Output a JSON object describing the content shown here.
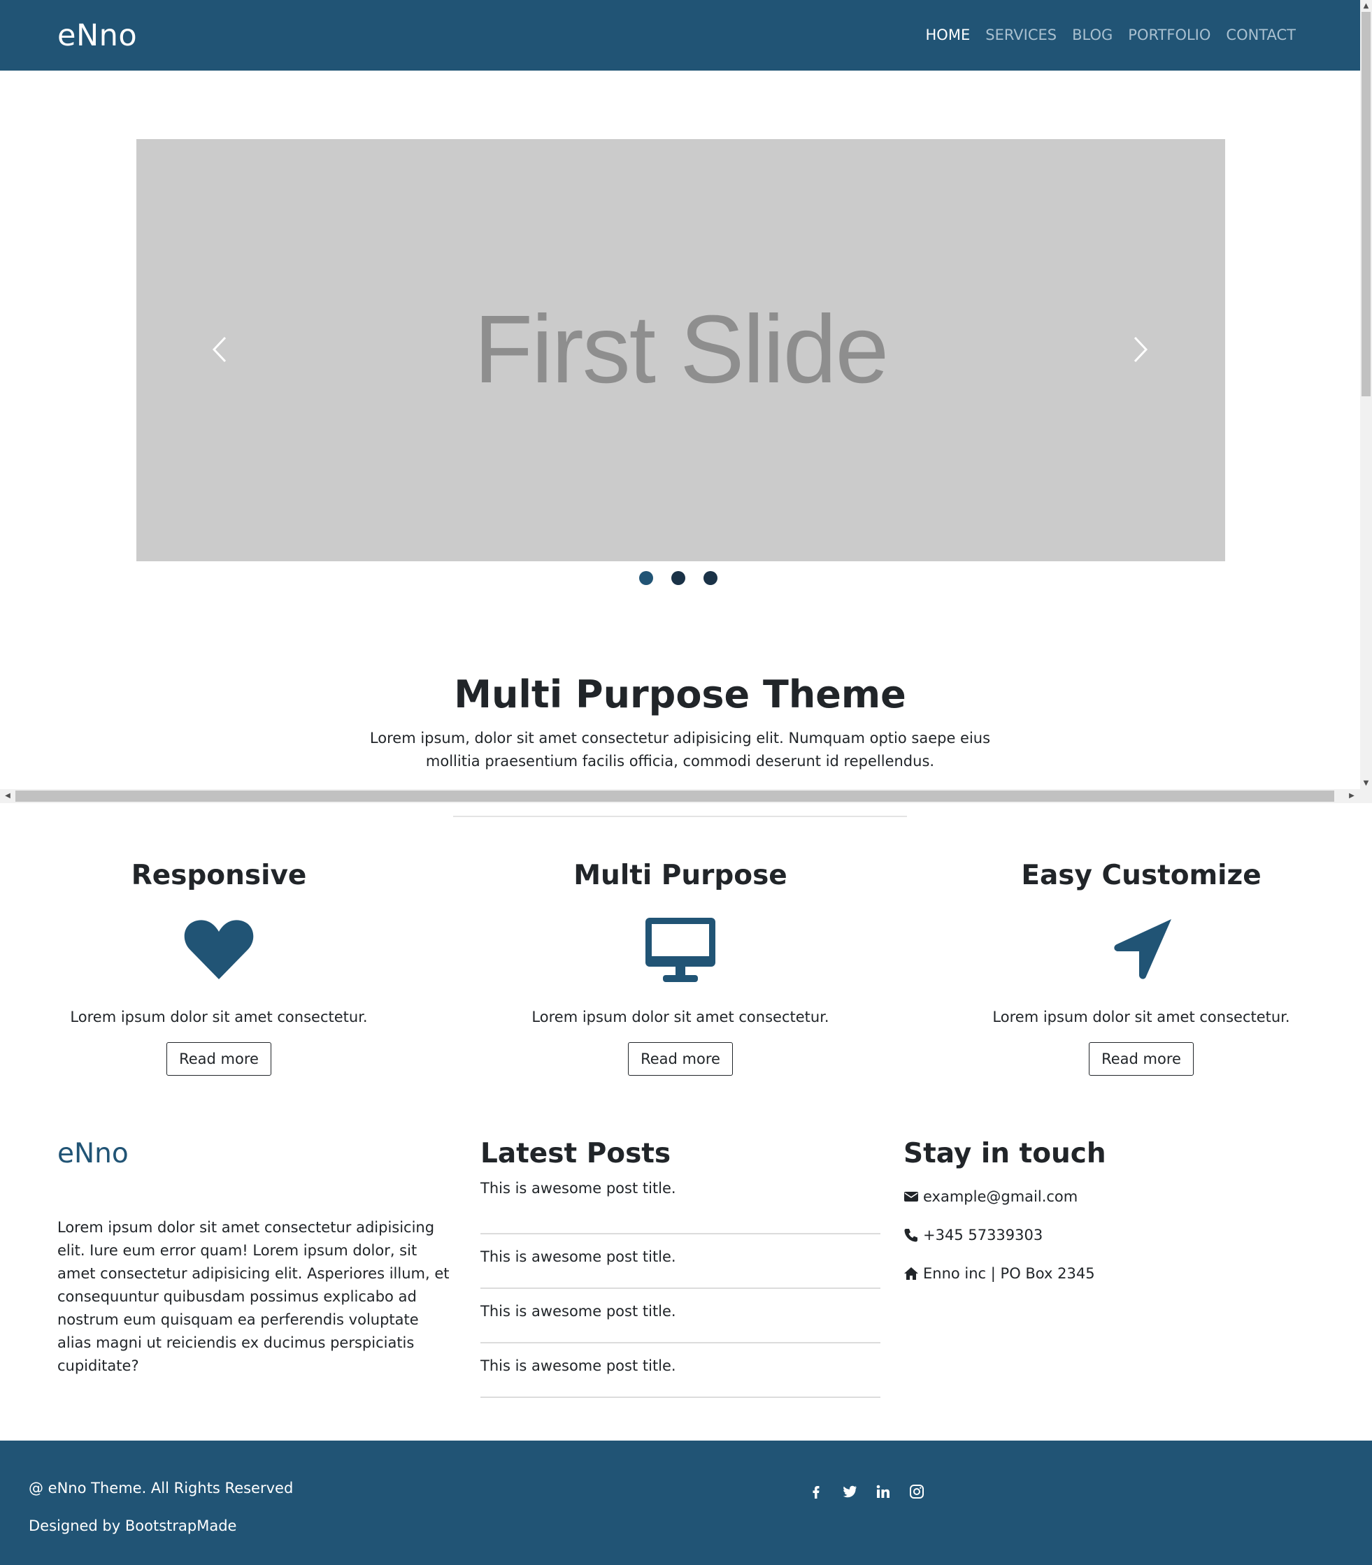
{
  "nav": {
    "brand": "eNno",
    "items": [
      {
        "label": "HOME"
      },
      {
        "label": "SERVICES"
      },
      {
        "label": "BLOG"
      },
      {
        "label": "PORTFOLIO"
      },
      {
        "label": "CONTACT"
      }
    ],
    "active_item": "HOME"
  },
  "slider": {
    "slide_text": "First Slide",
    "slide_count": 3,
    "active_index": 0
  },
  "intro": {
    "title": "Multi Purpose Theme",
    "text": "Lorem ipsum, dolor sit amet consectetur adipisicing elit. Numquam optio saepe eius mollitia praesentium facilis officia, commodi deserunt id repellendus."
  },
  "features": [
    {
      "title": "Responsive",
      "icon": "heart-icon",
      "text": "Lorem ipsum dolor sit amet consectetur.",
      "button": "Read more"
    },
    {
      "title": "Multi Purpose",
      "icon": "desktop-icon",
      "text": "Lorem ipsum dolor sit amet consectetur.",
      "button": "Read more"
    },
    {
      "title": "Easy Customize",
      "icon": "location-arrow-icon",
      "text": "Lorem ipsum dolor sit amet consectetur.",
      "button": "Read more"
    }
  ],
  "about": {
    "brand": "eNno",
    "text": "Lorem ipsum dolor sit amet consectetur adipisicing elit. Iure eum error quam! Lorem ipsum dolor, sit amet consectetur adipisicing elit. Asperiores illum, et consequuntur quibusdam possimus explicabo ad nostrum eum quisquam ea perferendis voluptate alias magni ut reiciendis ex ducimus perspiciatis cupiditate?"
  },
  "posts": {
    "title": "Latest Posts",
    "items": [
      "This is awesome post title.",
      "This is awesome post title.",
      "This is awesome post title.",
      "This is awesome post title."
    ]
  },
  "contact": {
    "title": "Stay in touch",
    "email": "example@gmail.com",
    "phone": "+345 57339303",
    "address": "Enno inc | PO Box 2345"
  },
  "footer": {
    "copyright": "@ eNno Theme. All Rights Reserved",
    "designed_by": "Designed by BootstrapMade",
    "socials": [
      "facebook-icon",
      "twitter-icon",
      "linkedin-icon",
      "instagram-icon"
    ]
  },
  "colors": {
    "brand": "#215475",
    "slide_bg": "#cbcbcb",
    "slide_text": "#8e8e8e"
  }
}
